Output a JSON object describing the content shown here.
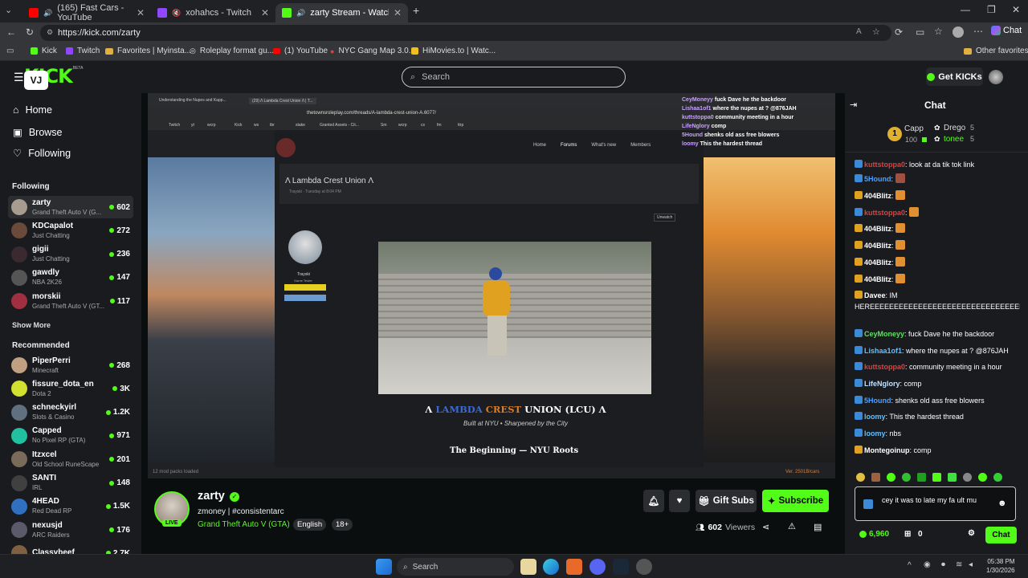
{
  "browser": {
    "tabs": [
      {
        "title": "(165) Fast Cars - YouTube",
        "favicon": "youtube",
        "color": "#ff0000"
      },
      {
        "title": "xohahcs - Twitch",
        "favicon": "twitch",
        "color": "#9146ff"
      },
      {
        "title": "zarty Stream - Watch Live on",
        "favicon": "kick",
        "color": "#53fc18"
      }
    ],
    "url": "https://kick.com/zarty",
    "bookmarks": [
      "Kick",
      "Twitch",
      "Favorites | Myinsta...",
      "Roleplay format gu...",
      "(1) YouTube",
      "NYC Gang Map 3.0...",
      "HiMovies.to | Watc..."
    ],
    "other_favorites": "Other favorites",
    "chat_label": "Chat"
  },
  "kick": {
    "logo": "KICK",
    "logo_tag": "BETA",
    "search_placeholder": "Search",
    "get_kicks": "Get KICKs"
  },
  "sidebar": {
    "nav": [
      {
        "label": "Home",
        "icon": "home-icon"
      },
      {
        "label": "Browse",
        "icon": "browse-icon"
      },
      {
        "label": "Following",
        "icon": "heart-icon"
      }
    ],
    "following_header": "Following",
    "following": [
      {
        "name": "zarty",
        "game": "Grand Theft Auto V (G...",
        "viewers": "602",
        "color": "#a89c90"
      },
      {
        "name": "KDCapalot",
        "game": "Just Chatting",
        "viewers": "272",
        "color": "#6a4a3a"
      },
      {
        "name": "gigii",
        "game": "Just Chatting",
        "viewers": "236",
        "color": "#3a2a30"
      },
      {
        "name": "gawdly",
        "game": "NBA 2K26",
        "viewers": "147",
        "color": "#555"
      },
      {
        "name": "morskii",
        "game": "Grand Theft Auto V (GT...",
        "viewers": "117",
        "color": "#a03040"
      }
    ],
    "show_more": "Show More",
    "recommended_header": "Recommended",
    "recommended": [
      {
        "name": "PiperPerri",
        "game": "Minecraft",
        "viewers": "268",
        "color": "#c0a080"
      },
      {
        "name": "fissure_dota_en",
        "game": "Dota 2",
        "viewers": "3K",
        "color": "#d4e030"
      },
      {
        "name": "schneckyirl",
        "game": "Slots & Casino",
        "viewers": "1.2K",
        "color": "#607080"
      },
      {
        "name": "Capped",
        "game": "No Pixel RP (GTA)",
        "viewers": "971",
        "color": "#20c0a0"
      },
      {
        "name": "Itzxcel",
        "game": "Old School RuneScape",
        "viewers": "201",
        "color": "#7a6a5a"
      },
      {
        "name": "SANTI",
        "game": "IRL",
        "viewers": "148",
        "color": "#404040"
      },
      {
        "name": "4HEAD",
        "game": "Red Dead RP",
        "viewers": "1.5K",
        "color": "#3070c0"
      },
      {
        "name": "nexusjd",
        "game": "ARC Raiders",
        "viewers": "176",
        "color": "#5a5a6a"
      },
      {
        "name": "Classybeef",
        "game": "",
        "viewers": "2.7K",
        "color": "#806040"
      }
    ]
  },
  "stream": {
    "inner_tabs": [
      "Understanding the Nupes and Kapp...",
      "(29) Λ Lambda Crest Union Λ | T..."
    ],
    "inner_url": "thetownsroleplay.com/threads/A-lambda-crest-union-A.6077/",
    "inner_bookmarks": [
      "Twitch",
      "yt",
      "wcrp",
      "Kick",
      "ws",
      "tbr",
      "stake",
      "Granted Assets - Cit...",
      "Sm",
      "wcrp",
      "cs",
      "fm",
      "ttrp"
    ],
    "forum_nav": [
      "Home",
      "Forums",
      "What's new",
      "Members"
    ],
    "thread_title": "Λ Lambda Crest Union Λ",
    "thread_meta": "Trayski · Tuesday at 8:04 PM",
    "unwatch": "Unwatch",
    "poster_name": "Trayski",
    "poster_role": "Game Tester",
    "heading_parts": [
      "Λ",
      "LAMBDA",
      "CREST",
      "UNION (LCU) Λ"
    ],
    "heading_sub": "Built at NYU • Sharpened by the City",
    "section_title": "The Beginning — NYU Roots",
    "footer_left": "12 mod packs loaded",
    "footer_right": "Ver. 2501B/cars",
    "overlay_chat": [
      {
        "user": "CeyMoneyy",
        "text": "fuck Dave he the backdoor"
      },
      {
        "user": "Lishaa1of1",
        "text": "where the nupes at ? @876JAH"
      },
      {
        "user": "kuttstoppa0",
        "text": "community meeting in a hour"
      },
      {
        "user": "LifeNglory",
        "text": "comp"
      },
      {
        "user": "5Hound",
        "text": "shenks old ass free blowers"
      },
      {
        "user": "loomy",
        "text": "This the hardest thread"
      }
    ]
  },
  "streamer": {
    "name": "zarty",
    "bio": "zmoney | #consistentarc",
    "category": "Grand Theft Auto V (GTA)",
    "language": "English",
    "age": "18+",
    "live": "LIVE",
    "gift_subs": "Gift Subs",
    "subscribe": "Subscribe",
    "viewers": "602",
    "viewers_label": "Viewers"
  },
  "chat": {
    "title": "Chat",
    "top_gifters": [
      {
        "name": "Capp",
        "count": "100",
        "rank": "1"
      },
      {
        "name": "Drego",
        "count": "5"
      },
      {
        "name": "tonee",
        "count": "5"
      }
    ],
    "messages": [
      {
        "user": "kuttstoppa0",
        "text": "look at da tik tok link",
        "color": "#e04040"
      },
      {
        "user": "5Hound",
        "text": "",
        "color": "#4aa0ff",
        "emote": true
      },
      {
        "user": "404Blitz",
        "text": "",
        "color": "#fff",
        "emote": true
      },
      {
        "user": "kuttstoppa0",
        "text": "",
        "color": "#e04040",
        "emote": true
      },
      {
        "user": "404Blitz",
        "text": "",
        "color": "#fff",
        "emote": true
      },
      {
        "user": "404Blitz",
        "text": "",
        "color": "#fff",
        "emote": true
      },
      {
        "user": "404Blitz",
        "text": "",
        "color": "#fff",
        "emote": true
      },
      {
        "user": "404Blitz",
        "text": "",
        "color": "#fff",
        "emote": true
      },
      {
        "user": "Davee",
        "text": "IM HEREEEEEEEEEEEEEEEEEEEEEEEEEEEEEEEEEEEEEEEEEEEEEEEEEEEEEEEEEE",
        "color": "#fff"
      },
      {
        "user": "CeyMoneyy",
        "text": "fuck Dave he the backdoor",
        "color": "#60e060"
      },
      {
        "user": "Lishaa1of1",
        "text": "where the nupes at ? @876JAH",
        "color": "#60c0ff"
      },
      {
        "user": "kuttstoppa0",
        "text": "community meeting in a hour",
        "color": "#e04040"
      },
      {
        "user": "LifeNglory",
        "text": "comp",
        "color": "#c0e0ff"
      },
      {
        "user": "5Hound",
        "text": "shenks old ass free blowers",
        "color": "#4aa0ff"
      },
      {
        "user": "loomy",
        "text": "This the hardest thread",
        "color": "#60c0ff"
      },
      {
        "user": "loomy",
        "text": "nbs",
        "color": "#60c0ff"
      },
      {
        "user": "Montegoinup",
        "text": "comp",
        "color": "#fff"
      }
    ],
    "input_value": "cey it was to late my fa ult mu",
    "points": "6,960",
    "gifts": "0",
    "chat_button": "Chat"
  },
  "taskbar": {
    "search": "Search",
    "time": "05:38 PM",
    "date": "1/30/2026"
  }
}
